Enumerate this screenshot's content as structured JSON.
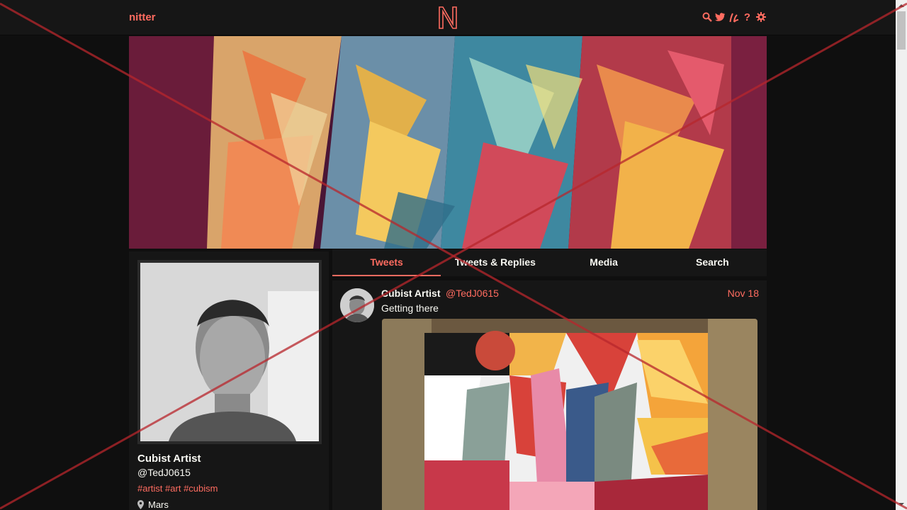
{
  "navbar": {
    "brand": "nitter",
    "icons": [
      "search-icon",
      "twitter-icon",
      "rss-icon",
      "help-icon",
      "gear-icon"
    ],
    "icon_glyphs": [
      "⚲",
      "🐦",
      "ℓ",
      "?",
      "⚙"
    ]
  },
  "profile": {
    "fullname": "Cubist Artist",
    "username": "@TedJ0615",
    "bio_tags": [
      "#artist",
      "#art",
      "#cubism"
    ],
    "location": "Mars"
  },
  "tabs": [
    {
      "label": "Tweets",
      "active": true
    },
    {
      "label": "Tweets & Replies",
      "active": false
    },
    {
      "label": "Media",
      "active": false
    },
    {
      "label": "Search",
      "active": false
    }
  ],
  "tweet": {
    "fullname": "Cubist Artist",
    "username": "@TedJ0615",
    "date": "Nov 18",
    "text": "Getting there"
  },
  "colors": {
    "accent": "#ff6c60",
    "background": "#0f0f0f",
    "panel": "#161616"
  }
}
